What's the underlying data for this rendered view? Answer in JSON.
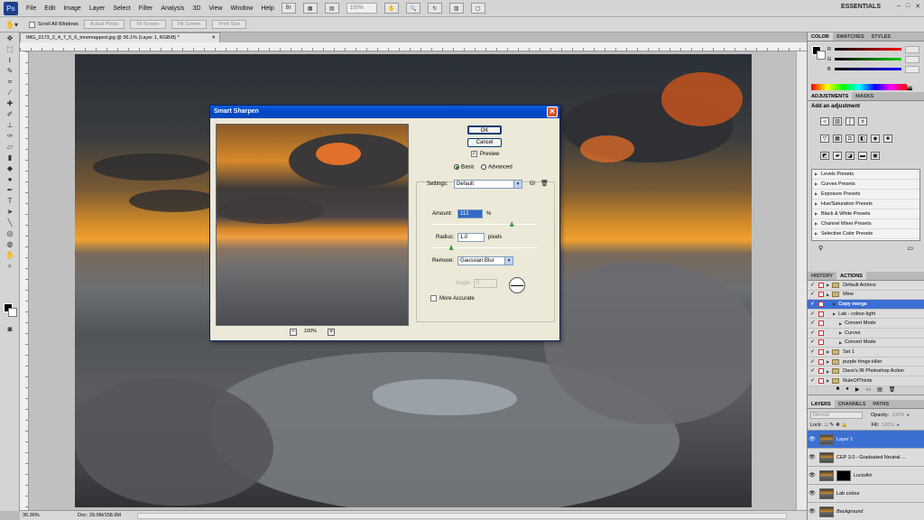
{
  "menubar": {
    "logo": "Ps",
    "items": [
      "File",
      "Edit",
      "Image",
      "Layer",
      "Select",
      "Filter",
      "Analysis",
      "3D",
      "View",
      "Window",
      "Help"
    ],
    "zoom": "100%",
    "workspace": "ESSENTIALS",
    "win_controls": [
      "–",
      "□",
      "✕"
    ]
  },
  "options": {
    "scroll_all": "Scroll All Windows",
    "buttons": [
      "Actual Pixels",
      "Fit Screen",
      "Fill Screen",
      "Print Size"
    ]
  },
  "document": {
    "tab_title": "IMG_0173_2_4_7_5_6_tonemapped.jpg @ 36.1% (Layer 1, RGB/8) *",
    "zoom": "36.36%",
    "doc_size": "Doc: 29.0M/158.9M"
  },
  "color_panel": {
    "tabs": [
      "COLOR",
      "SWATCHES",
      "STYLES"
    ],
    "channels": [
      "R",
      "G",
      "B"
    ],
    "colors": {
      "r": "#e02020",
      "g": "#20a020",
      "b": "#2040e0"
    }
  },
  "adjustments": {
    "tabs": [
      "ADJUSTMENTS",
      "MASKS"
    ],
    "title": "Add an adjustment",
    "presets": [
      "Levels Presets",
      "Curves Presets",
      "Exposure Presets",
      "Hue/Saturation Presets",
      "Black & White Presets",
      "Channel Mixer Presets",
      "Selective Color Presets"
    ]
  },
  "history": {
    "tabs": [
      "HISTORY",
      "ACTIONS"
    ],
    "rows": [
      {
        "label": "Default Actions",
        "selected": false,
        "indent": 0
      },
      {
        "label": "Mine",
        "selected": false,
        "indent": 0
      },
      {
        "label": "Copy merge",
        "selected": true,
        "indent": 1
      },
      {
        "label": "Lab - colour-light",
        "selected": false,
        "indent": 1
      },
      {
        "label": "Convert Mode",
        "selected": false,
        "indent": 2
      },
      {
        "label": "Curves",
        "selected": false,
        "indent": 2
      },
      {
        "label": "Convert Mode",
        "selected": false,
        "indent": 2
      },
      {
        "label": "Set 1",
        "selected": false,
        "indent": 0
      },
      {
        "label": "purple fringe killer",
        "selected": false,
        "indent": 0
      },
      {
        "label": "Dave's IR Photoshop Action",
        "selected": false,
        "indent": 0
      },
      {
        "label": "RuleOfThirds",
        "selected": false,
        "indent": 0
      }
    ]
  },
  "layers": {
    "tabs": [
      "LAYERS",
      "CHANNELS",
      "PATHS"
    ],
    "blend_mode": "Normal",
    "opacity_label": "Opacity:",
    "opacity": "100%",
    "lock_label": "Lock:",
    "fill_label": "Fill:",
    "fill": "100%",
    "rows": [
      {
        "name": "Layer 1",
        "selected": true,
        "mask": false
      },
      {
        "name": "CEP 3.0 - Graduated Neutral ...",
        "selected": false,
        "mask": false
      },
      {
        "name": "LucisArt",
        "selected": false,
        "mask": true
      },
      {
        "name": "Lab colour",
        "selected": false,
        "mask": false
      },
      {
        "name": "Background",
        "selected": false,
        "mask": false
      }
    ]
  },
  "dialog": {
    "title": "Smart Sharpen",
    "ok": "OK",
    "cancel": "Cancel",
    "preview": "Preview",
    "basic": "Basic",
    "advanced": "Advanced",
    "settings_label": "Settings:",
    "settings_value": "Default",
    "amount_label": "Amount:",
    "amount_value": "112",
    "amount_unit": "%",
    "amount_fraction": 0.224,
    "radius_label": "Radius:",
    "radius_value": "1.0",
    "radius_unit": "pixels",
    "radius_fraction": 0.16,
    "remove_label": "Remove:",
    "remove_value": "Gaussian Blur",
    "angle_label": "Angle:",
    "angle_value": "0",
    "more_accurate": "More Accurate",
    "preview_zoom": "100%"
  }
}
